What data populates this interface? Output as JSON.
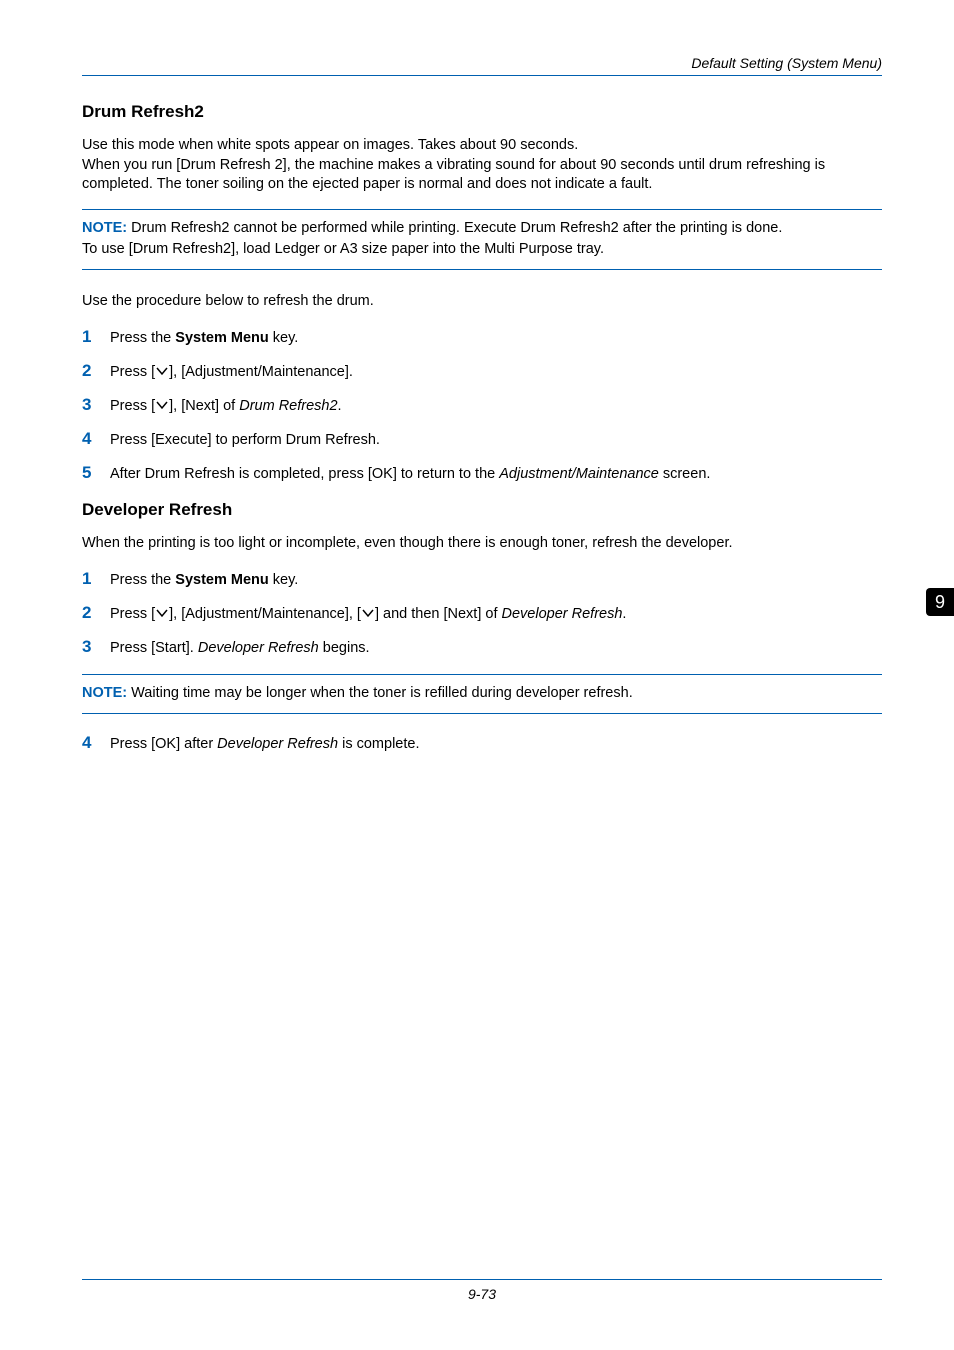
{
  "header": "Default Setting (System Menu)",
  "side_tab": "9",
  "section1": {
    "heading": "Drum Refresh2",
    "intro": "Use this mode when white spots appear on images. Takes about 90 seconds.\nWhen you run [Drum Refresh 2], the machine makes a vibrating sound for about 90 seconds until drum refreshing is completed. The toner soiling on the ejected paper is normal and does not indicate a fault.",
    "note": {
      "label": "NOTE:",
      "line1": " Drum Refresh2 cannot be performed while printing. Execute Drum Refresh2 after the printing is done.",
      "line2": "To use [Drum Refresh2], load Ledger or A3 size paper into the Multi Purpose tray."
    },
    "procedure_text": "Use the procedure below to refresh the drum.",
    "steps": {
      "s1_a": "Press the ",
      "s1_bold": "System Menu",
      "s1_b": " key.",
      "s2_a": "Press [",
      "s2_b": "], [Adjustment/Maintenance].",
      "s3_a": "Press [",
      "s3_b": "], [Next] of ",
      "s3_italic": "Drum Refresh2",
      "s3_c": ".",
      "s4": "Press [Execute] to perform Drum Refresh.",
      "s5_a": "After Drum Refresh is completed, press [OK] to return to the ",
      "s5_italic": "Adjustment/Maintenance",
      "s5_b": " screen."
    }
  },
  "section2": {
    "heading": "Developer Refresh",
    "intro": "When the printing is too light or incomplete, even though there is enough toner, refresh the developer.",
    "steps": {
      "s1_a": "Press the ",
      "s1_bold": "System Menu",
      "s1_b": " key.",
      "s2_a": "Press [",
      "s2_b": "], [Adjustment/Maintenance], [",
      "s2_c": "] and then [Next] of ",
      "s2_italic": "Developer Refresh",
      "s2_d": ".",
      "s3_a": "Press [Start]. ",
      "s3_italic": "Developer Refresh",
      "s3_b": " begins."
    },
    "note": {
      "label": "NOTE:",
      "text": " Waiting time may be longer when the toner is refilled during developer refresh."
    },
    "steps_cont": {
      "s4_a": "Press [OK] after ",
      "s4_italic": "Developer Refresh",
      "s4_b": " is complete."
    }
  },
  "nums": {
    "n1": "1",
    "n2": "2",
    "n3": "3",
    "n4": "4",
    "n5": "5"
  },
  "footer": "9-73"
}
